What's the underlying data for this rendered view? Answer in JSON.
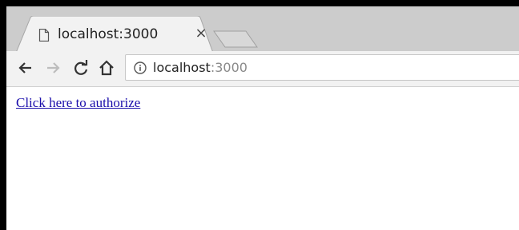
{
  "tab": {
    "title": "localhost:3000",
    "close_label": "×",
    "favicon_icon": "document-icon"
  },
  "toolbar": {
    "back_icon": "back-arrow-icon",
    "forward_icon": "forward-arrow-icon",
    "reload_icon": "reload-icon",
    "home_icon": "home-icon"
  },
  "address_bar": {
    "info_icon": "info-icon",
    "host": "localhost",
    "port": ":3000"
  },
  "page": {
    "link_text": "Click here to authorize"
  }
}
